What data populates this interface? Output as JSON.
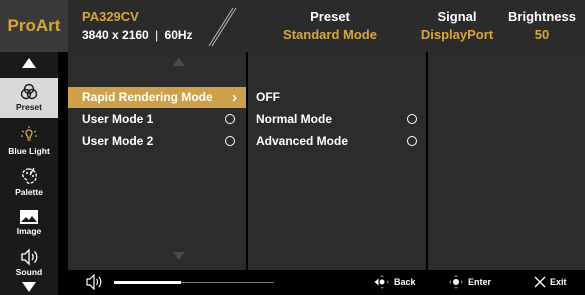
{
  "header": {
    "logo": "ProArt",
    "model": "PA329CV",
    "resolution": "3840 x 2160",
    "refresh_separator": "|",
    "refresh": "60Hz",
    "preset": {
      "title": "Preset",
      "value": "Standard Mode"
    },
    "signal": {
      "title": "Signal",
      "value": "DisplayPort"
    },
    "brightness": {
      "title": "Brightness",
      "value": "50"
    }
  },
  "sidebar": {
    "items": [
      {
        "label": "Preset",
        "icon": "preset-icon",
        "active": true
      },
      {
        "label": "Blue Light",
        "icon": "blue-light-icon",
        "active": false
      },
      {
        "label": "Palette",
        "icon": "palette-icon",
        "active": false
      },
      {
        "label": "Image",
        "icon": "image-icon",
        "active": false
      },
      {
        "label": "Sound",
        "icon": "sound-icon",
        "active": false
      }
    ]
  },
  "menu": {
    "items": [
      {
        "label": "Rapid Rendering Mode",
        "selected": true,
        "control": "chevron"
      },
      {
        "label": "User Mode 1",
        "selected": false,
        "control": "radio"
      },
      {
        "label": "User Mode 2",
        "selected": false,
        "control": "radio"
      }
    ]
  },
  "submenu": {
    "items": [
      {
        "label": "OFF",
        "control": "none"
      },
      {
        "label": "Normal Mode",
        "control": "radio"
      },
      {
        "label": "Advanced Mode",
        "control": "radio"
      }
    ]
  },
  "footer": {
    "volume_level_percent": 42,
    "back_label": "Back",
    "enter_label": "Enter",
    "exit_label": "Exit"
  },
  "colors": {
    "accent": "#d7a63b",
    "selection": "#cfa04a",
    "panel": "#2c2c2c",
    "header": "#2b2b2b"
  }
}
